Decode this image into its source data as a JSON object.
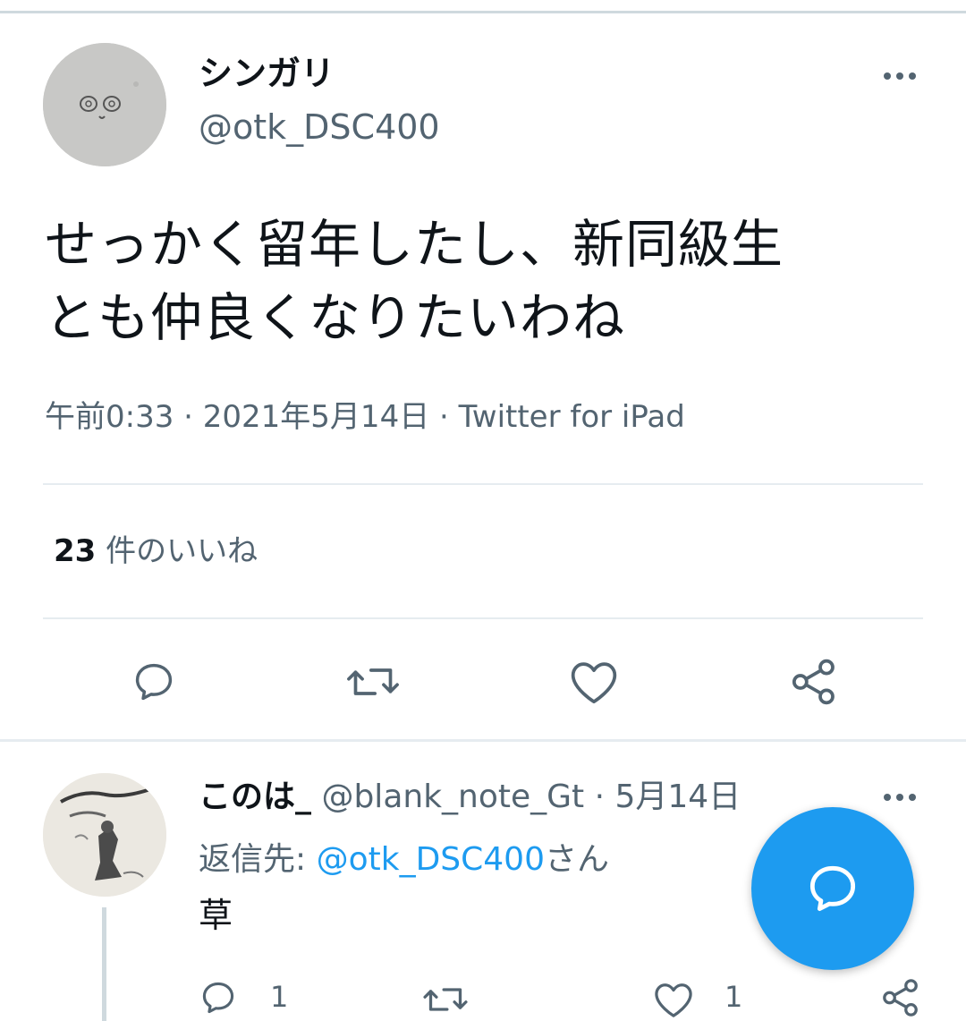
{
  "tweet": {
    "author": {
      "name": "シンガリ",
      "handle": "@otk_DSC400"
    },
    "text_line1": "せっかく留年したし、新同級生",
    "text_line2": "とも仲良くなりたいわね",
    "meta": "午前0:33 · 2021年5月14日 · Twitter for iPad",
    "likes": {
      "count": "23",
      "label": " 件のいいね"
    },
    "icons": [
      "reply-icon",
      "retweet-icon",
      "like-icon",
      "share-icon",
      "more-icon"
    ]
  },
  "reply": {
    "name": "このは_",
    "meta": " @blank_note_Gt · 5月14日",
    "reply_to_prefix": "返信先: ",
    "reply_to_mention": "@otk_DSC400",
    "reply_to_suffix": "さん",
    "text": "草",
    "reply_count": "1",
    "like_count": "1"
  },
  "fab": {
    "icon": "compose-reply-icon"
  },
  "colors": {
    "accent": "#1d9bf0",
    "text": "#0f1419",
    "secondary": "#536471",
    "divider": "#e6ecf0"
  }
}
